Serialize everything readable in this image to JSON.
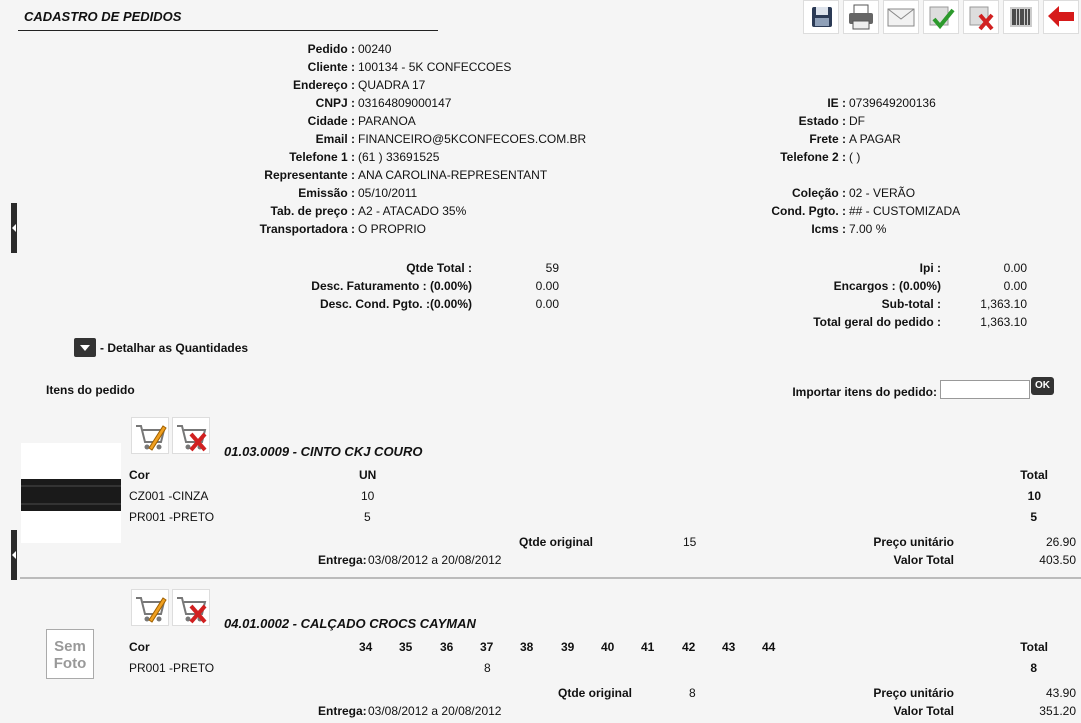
{
  "page": {
    "title": "CADASTRO DE PEDIDOS"
  },
  "toolbar": [
    "save-icon",
    "printer-icon",
    "email-icon",
    "approve-icon",
    "cancel-icon",
    "barcode-icon",
    "back-arrow-icon"
  ],
  "order_left": [
    {
      "label": "Pedido :",
      "value": "00240"
    },
    {
      "label": "Cliente :",
      "value": "100134 - 5K CONFECCOES"
    },
    {
      "label": "Endereço :",
      "value": "QUADRA 17"
    },
    {
      "label": "CNPJ :",
      "value": "03164809000147"
    },
    {
      "label": "Cidade :",
      "value": "PARANOA"
    },
    {
      "label": "Email :",
      "value": "FINANCEIRO@5KCONFECOES.COM.BR"
    },
    {
      "label": "Telefone 1 :",
      "value": "(61 ) 33691525"
    },
    {
      "label": "Representante :",
      "value": "ANA CAROLINA-REPRESENTANT"
    },
    {
      "label": "Emissão :",
      "value": "05/10/2011"
    },
    {
      "label": "Tab. de preço :",
      "value": "A2 - ATACADO 35%"
    },
    {
      "label": "Transportadora :",
      "value": "O PROPRIO"
    }
  ],
  "order_right": [
    {
      "label": "IE :",
      "value": "0739649200136"
    },
    {
      "label": "Estado :",
      "value": "DF"
    },
    {
      "label": "Frete :",
      "value": "A PAGAR"
    },
    {
      "label": "Telefone 2 :",
      "value": "( )"
    },
    {
      "label": "Coleção :",
      "value": "02 - VERÃO"
    },
    {
      "label": "Cond. Pgto. :",
      "value": "## - CUSTOMIZADA"
    },
    {
      "label": "Icms :",
      "value": "7.00 %"
    }
  ],
  "totals_left": [
    {
      "label": "Qtde Total :",
      "value": "59"
    },
    {
      "label": "Desc. Faturamento : (0.00%)",
      "value": "0.00"
    },
    {
      "label": "Desc. Cond. Pgto. :(0.00%)",
      "value": "0.00"
    }
  ],
  "totals_right": [
    {
      "label": "Ipi :",
      "value": "0.00"
    },
    {
      "label": "Encargos : (0.00%)",
      "value": "0.00"
    },
    {
      "label": "Sub-total :",
      "value": "1,363.10"
    },
    {
      "label": "Total geral do pedido :",
      "value": "1,363.10"
    }
  ],
  "detail_toggle_label": "- Detalhar as Quantidades",
  "items_heading": "Itens do pedido",
  "import_label": "Importar itens do pedido:",
  "import_value": "",
  "ok_label": "OK",
  "products": [
    {
      "title": "01.03.0009 - CINTO CKJ COURO",
      "col_cor": "Cor",
      "sizes": [
        "UN"
      ],
      "col_total": "Total",
      "rows": [
        {
          "cor": "CZ001 -CINZA",
          "qty": [
            "10"
          ],
          "total": "10"
        },
        {
          "cor": "PR001 -PRETO",
          "qty": [
            "5"
          ],
          "total": "5"
        }
      ],
      "qtde_original_label": "Qtde original",
      "qtde_original": "15",
      "preco_label": "Preço unitário",
      "preco": "26.90",
      "entrega_label": "Entrega:",
      "entrega": "03/08/2012 a 20/08/2012",
      "valor_label": "Valor Total",
      "valor": "403.50"
    },
    {
      "title": "04.01.0002 - CALÇADO CROCS CAYMAN",
      "col_cor": "Cor",
      "sizes": [
        "34",
        "35",
        "36",
        "37",
        "38",
        "39",
        "40",
        "41",
        "42",
        "43",
        "44"
      ],
      "col_total": "Total",
      "rows": [
        {
          "cor": "PR001 -PRETO",
          "qty": [
            "",
            "",
            "",
            "8",
            "",
            "",
            "",
            "",
            "",
            "",
            ""
          ],
          "total": "8"
        }
      ],
      "qtde_original_label": "Qtde original",
      "qtde_original": "8",
      "preco_label": "Preço unitário",
      "preco": "43.90",
      "entrega_label": "Entrega:",
      "entrega": "03/08/2012 a 20/08/2012",
      "valor_label": "Valor Total",
      "valor": "351.20",
      "no_photo_line1": "Sem",
      "no_photo_line2": "Foto"
    }
  ]
}
